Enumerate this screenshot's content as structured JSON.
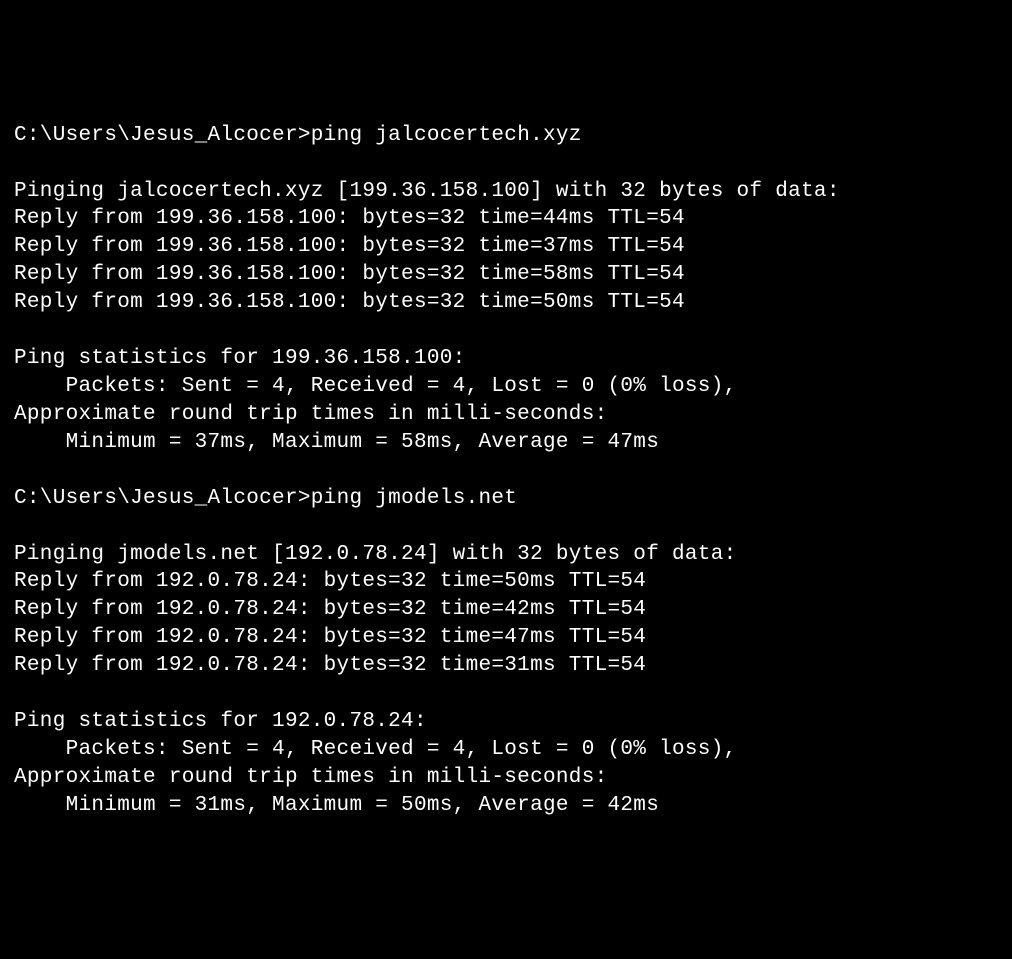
{
  "terminal": {
    "prompt_path": "C:\\Users\\Jesus_Alcocer",
    "session1": {
      "command": "ping jalcocertech.xyz",
      "header": "Pinging jalcocertech.xyz [199.36.158.100] with 32 bytes of data:",
      "reply1": "Reply from 199.36.158.100: bytes=32 time=44ms TTL=54",
      "reply2": "Reply from 199.36.158.100: bytes=32 time=37ms TTL=54",
      "reply3": "Reply from 199.36.158.100: bytes=32 time=58ms TTL=54",
      "reply4": "Reply from 199.36.158.100: bytes=32 time=50ms TTL=54",
      "stats_header": "Ping statistics for 199.36.158.100:",
      "packets_line": "    Packets: Sent = 4, Received = 4, Lost = 0 (0% loss),",
      "rtt_header": "Approximate round trip times in milli-seconds:",
      "rtt_line": "    Minimum = 37ms, Maximum = 58ms, Average = 47ms"
    },
    "session2": {
      "command": "ping jmodels.net",
      "header": "Pinging jmodels.net [192.0.78.24] with 32 bytes of data:",
      "reply1": "Reply from 192.0.78.24: bytes=32 time=50ms TTL=54",
      "reply2": "Reply from 192.0.78.24: bytes=32 time=42ms TTL=54",
      "reply3": "Reply from 192.0.78.24: bytes=32 time=47ms TTL=54",
      "reply4": "Reply from 192.0.78.24: bytes=32 time=31ms TTL=54",
      "stats_header": "Ping statistics for 192.0.78.24:",
      "packets_line": "    Packets: Sent = 4, Received = 4, Lost = 0 (0% loss),",
      "rtt_header": "Approximate round trip times in milli-seconds:",
      "rtt_line": "    Minimum = 31ms, Maximum = 50ms, Average = 42ms"
    }
  }
}
